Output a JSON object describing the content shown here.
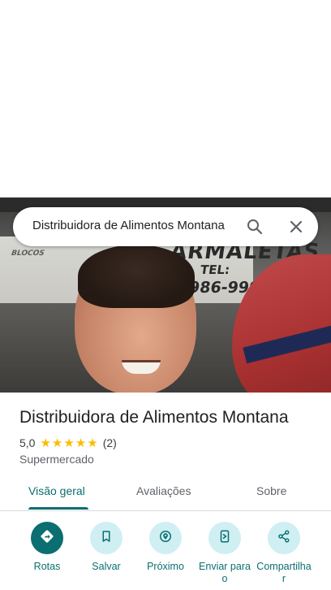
{
  "search": {
    "query": "Distribuidora de Alimentos Montana"
  },
  "photo": {
    "sign_line_1": "ARMALETAS",
    "sign_line_2": "TEL:",
    "sign_line_3": "986-9992",
    "sign_left": "BLOCOS"
  },
  "place": {
    "title": "Distribuidora de Alimentos Montana",
    "rating": "5,0",
    "stars": 5,
    "reviews": "(2)",
    "category": "Supermercado"
  },
  "tabs": [
    {
      "label": "Visão geral",
      "active": true
    },
    {
      "label": "Avaliações",
      "active": false
    },
    {
      "label": "Sobre",
      "active": false
    }
  ],
  "actions": [
    {
      "label": "Rotas",
      "icon": "directions-icon"
    },
    {
      "label": "Salvar",
      "icon": "bookmark-icon"
    },
    {
      "label": "Próximo",
      "icon": "nearby-icon"
    },
    {
      "label": "Enviar para o",
      "icon": "send-to-phone-icon"
    },
    {
      "label": "Compartilha r",
      "icon": "share-icon"
    }
  ],
  "colors": {
    "accent": "#0b6e70",
    "action_bg": "#cfeff3",
    "star": "#fbbc04"
  }
}
